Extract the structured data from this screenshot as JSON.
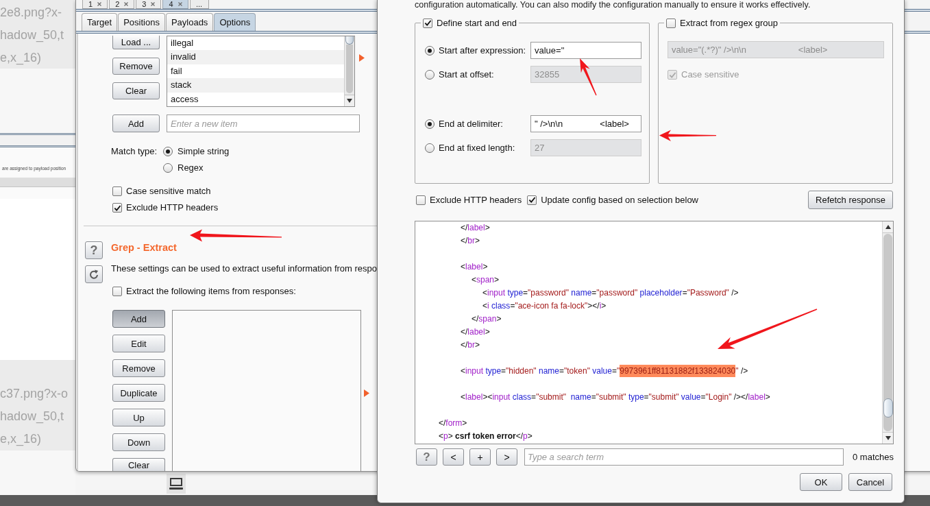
{
  "background_page": {
    "upper_snippet": [
      "2e8.png?x-",
      "hadow_50,t",
      "e,x_16)"
    ],
    "thumbnail": {
      "caption": "are assigned to payload position"
    },
    "lower_snippet": [
      "c37.png?x-o",
      "hadow_50,t",
      "e,x_16)"
    ]
  },
  "intruder_window": {
    "request_tabs": [
      {
        "label": "1",
        "closable": true,
        "selected": false
      },
      {
        "label": "2",
        "closable": true,
        "selected": false
      },
      {
        "label": "3",
        "closable": true,
        "selected": false
      },
      {
        "label": "4",
        "closable": true,
        "selected": true
      },
      {
        "label": "...",
        "closable": false,
        "selected": false
      }
    ],
    "tabs": [
      {
        "label": "Target",
        "selected": false
      },
      {
        "label": "Positions",
        "selected": false
      },
      {
        "label": "Payloads",
        "selected": false
      },
      {
        "label": "Options",
        "selected": true
      }
    ],
    "grep_match": {
      "list_buttons": [
        "Load ...",
        "Remove",
        "Clear"
      ],
      "items": [
        "illegal",
        "invalid",
        "fail",
        "stack",
        "access"
      ],
      "add_button": "Add",
      "new_item": {
        "placeholder": "Enter a new item"
      },
      "match_type": {
        "label": "Match type:",
        "options": [
          {
            "label": "Simple string",
            "selected": true
          },
          {
            "label": "Regex",
            "selected": false
          }
        ]
      },
      "options": [
        {
          "label": "Case sensitive match",
          "checked": false
        },
        {
          "label": "Exclude HTTP headers",
          "checked": true
        }
      ]
    },
    "grep_extract": {
      "help_button": "?",
      "title": "Grep - Extract",
      "description": "These settings can be used to extract useful information from respo",
      "enable": {
        "label": "Extract the following items from responses:",
        "checked": false
      },
      "buttons": [
        {
          "label": "Add",
          "pressed": true
        },
        {
          "label": "Edit",
          "pressed": false
        },
        {
          "label": "Remove",
          "pressed": false
        },
        {
          "label": "Duplicate",
          "pressed": false
        },
        {
          "label": "Up",
          "pressed": false
        },
        {
          "label": "Down",
          "pressed": false
        },
        {
          "label": "Clear",
          "pressed": false
        }
      ]
    }
  },
  "dialog": {
    "intro": "configuration automatically. You can also modify the configuration manually to ensure it works effectively.",
    "define_group": {
      "label": "Define start and end",
      "checked": true,
      "start_options": [
        {
          "label": "Start after expression:",
          "selected": true,
          "field": {
            "value": "value=\"",
            "disabled": false
          }
        },
        {
          "label": "Start at offset:",
          "selected": false,
          "field": {
            "value": "32855",
            "disabled": true
          }
        }
      ],
      "end_options": [
        {
          "label": "End at delimiter:",
          "selected": true,
          "field": {
            "value": "\" />\\n\\n               <label>",
            "disabled": false
          }
        },
        {
          "label": "End at fixed length:",
          "selected": false,
          "field": {
            "value": "27",
            "disabled": true
          }
        }
      ]
    },
    "regex_group": {
      "label": "Extract from regex group",
      "checked": false,
      "pattern": {
        "value": "value=\"(.*?)\" />\\n\\n                     <label>",
        "disabled": true
      },
      "case_sensitive": {
        "label": "Case sensitive",
        "checked": true,
        "disabled": true
      }
    },
    "exclude_headers": {
      "label": "Exclude HTTP headers",
      "checked": false
    },
    "update_config": {
      "label": "Update config based on selection below",
      "checked": true
    },
    "refetch_button": "Refetch response",
    "response_lines": [
      {
        "kind": "code",
        "segments": [
          {
            "kind": "punct",
            "text": "                </"
          },
          {
            "kind": "tag",
            "text": "label"
          },
          {
            "kind": "punct",
            "text": ">"
          }
        ]
      },
      {
        "kind": "code",
        "segments": [
          {
            "kind": "punct",
            "text": "                </"
          },
          {
            "kind": "tag",
            "text": "br"
          },
          {
            "kind": "punct",
            "text": ">"
          }
        ]
      },
      {
        "kind": "blank"
      },
      {
        "kind": "code",
        "segments": [
          {
            "kind": "punct",
            "text": "                <"
          },
          {
            "kind": "tag",
            "text": "label"
          },
          {
            "kind": "punct",
            "text": ">"
          }
        ]
      },
      {
        "kind": "code",
        "segments": [
          {
            "kind": "punct",
            "text": "                    <"
          },
          {
            "kind": "tag",
            "text": "span"
          },
          {
            "kind": "punct",
            "text": ">"
          }
        ]
      },
      {
        "kind": "code",
        "segments": [
          {
            "kind": "punct",
            "text": "                        <"
          },
          {
            "kind": "tag",
            "text": "input"
          },
          {
            "kind": "attr",
            "text": " type"
          },
          {
            "kind": "punct",
            "text": "="
          },
          {
            "kind": "value",
            "text": "\"password\""
          },
          {
            "kind": "attr",
            "text": " name"
          },
          {
            "kind": "punct",
            "text": "="
          },
          {
            "kind": "value",
            "text": "\"password\""
          },
          {
            "kind": "attr",
            "text": " placeholder"
          },
          {
            "kind": "punct",
            "text": "="
          },
          {
            "kind": "value",
            "text": "\"Password\""
          },
          {
            "kind": "punct",
            "text": " />"
          }
        ]
      },
      {
        "kind": "code",
        "segments": [
          {
            "kind": "punct",
            "text": "                        <"
          },
          {
            "kind": "tag",
            "text": "i"
          },
          {
            "kind": "attr",
            "text": " class"
          },
          {
            "kind": "punct",
            "text": "="
          },
          {
            "kind": "value",
            "text": "\"ace-icon fa fa-lock\""
          },
          {
            "kind": "punct",
            "text": "></"
          },
          {
            "kind": "tag",
            "text": "i"
          },
          {
            "kind": "punct",
            "text": ">"
          }
        ]
      },
      {
        "kind": "code",
        "segments": [
          {
            "kind": "punct",
            "text": "                    </"
          },
          {
            "kind": "tag",
            "text": "span"
          },
          {
            "kind": "punct",
            "text": ">"
          }
        ]
      },
      {
        "kind": "code",
        "segments": [
          {
            "kind": "punct",
            "text": "                </"
          },
          {
            "kind": "tag",
            "text": "label"
          },
          {
            "kind": "punct",
            "text": ">"
          }
        ]
      },
      {
        "kind": "code",
        "segments": [
          {
            "kind": "punct",
            "text": "                </"
          },
          {
            "kind": "tag",
            "text": "br"
          },
          {
            "kind": "punct",
            "text": ">"
          }
        ]
      },
      {
        "kind": "blank"
      },
      {
        "kind": "code",
        "segments": [
          {
            "kind": "punct",
            "text": "                <"
          },
          {
            "kind": "tag",
            "text": "input"
          },
          {
            "kind": "attr",
            "text": " type"
          },
          {
            "kind": "punct",
            "text": "="
          },
          {
            "kind": "value",
            "text": "\"hidden\""
          },
          {
            "kind": "attr",
            "text": " name"
          },
          {
            "kind": "punct",
            "text": "="
          },
          {
            "kind": "value",
            "text": "\"token\""
          },
          {
            "kind": "attr",
            "text": " value"
          },
          {
            "kind": "punct",
            "text": "="
          },
          {
            "kind": "value",
            "text": "\""
          },
          {
            "kind": "highlight",
            "text": "9973961ff81131882f133824030"
          },
          {
            "kind": "value",
            "text": "\""
          },
          {
            "kind": "punct",
            "text": " />"
          }
        ]
      },
      {
        "kind": "blank"
      },
      {
        "kind": "code",
        "segments": [
          {
            "kind": "punct",
            "text": "                <"
          },
          {
            "kind": "tag",
            "text": "label"
          },
          {
            "kind": "punct",
            "text": "><"
          },
          {
            "kind": "tag",
            "text": "input"
          },
          {
            "kind": "attr",
            "text": " class"
          },
          {
            "kind": "punct",
            "text": "="
          },
          {
            "kind": "value",
            "text": "\"submit\""
          },
          {
            "kind": "attr",
            "text": "  name"
          },
          {
            "kind": "punct",
            "text": "="
          },
          {
            "kind": "value",
            "text": "\"submit\""
          },
          {
            "kind": "attr",
            "text": " type"
          },
          {
            "kind": "punct",
            "text": "="
          },
          {
            "kind": "value",
            "text": "\"submit\""
          },
          {
            "kind": "attr",
            "text": " value"
          },
          {
            "kind": "punct",
            "text": "="
          },
          {
            "kind": "value",
            "text": "\"Login\""
          },
          {
            "kind": "punct",
            "text": " /></"
          },
          {
            "kind": "tag",
            "text": "label"
          },
          {
            "kind": "punct",
            "text": ">"
          }
        ]
      },
      {
        "kind": "blank"
      },
      {
        "kind": "code",
        "segments": [
          {
            "kind": "punct",
            "text": "        </"
          },
          {
            "kind": "tag",
            "text": "form"
          },
          {
            "kind": "punct",
            "text": ">"
          }
        ]
      },
      {
        "kind": "code",
        "segments": [
          {
            "kind": "punct",
            "text": "        <"
          },
          {
            "kind": "tag",
            "text": "p"
          },
          {
            "kind": "punct",
            "text": ">"
          },
          {
            "kind": "bold",
            "text": " csrf token error"
          },
          {
            "kind": "punct",
            "text": "</"
          },
          {
            "kind": "tag",
            "text": "p"
          },
          {
            "kind": "punct",
            "text": ">"
          }
        ]
      }
    ],
    "search_buttons": [
      "?",
      "<",
      "+",
      ">"
    ],
    "search": {
      "placeholder": "Type a search term"
    },
    "matches": "0 matches",
    "buttons": [
      "OK",
      "Cancel"
    ]
  }
}
